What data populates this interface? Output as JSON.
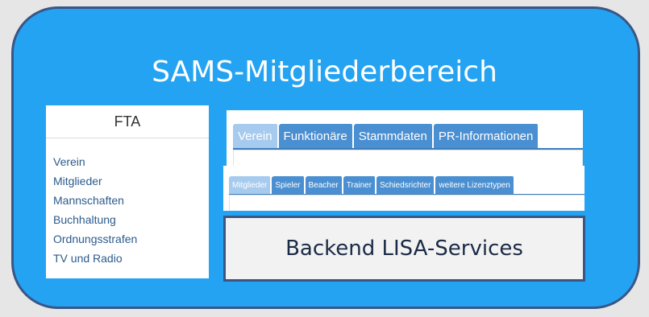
{
  "diagram": {
    "title": "SAMS-Mitgliederbereich"
  },
  "fta_menu": {
    "heading": "FTA",
    "items": [
      "Verein",
      "Mitglieder",
      "Mannschaften",
      "Buchhaltung",
      "Ordnungsstrafen",
      "TV und Radio"
    ]
  },
  "primary_tabs": {
    "items": [
      {
        "label": "Verein",
        "active": true
      },
      {
        "label": "Funktionäre",
        "active": false
      },
      {
        "label": "Stammdaten",
        "active": false
      },
      {
        "label": "PR-Informationen",
        "active": false
      }
    ]
  },
  "secondary_tabs": {
    "items": [
      {
        "label": "Mitglieder",
        "active": true
      },
      {
        "label": "Spieler",
        "active": false
      },
      {
        "label": "Beacher",
        "active": false
      },
      {
        "label": "Trainer",
        "active": false
      },
      {
        "label": "Schiedsrichter",
        "active": false
      },
      {
        "label": "weitere Lizenztypen",
        "active": false
      }
    ]
  },
  "backend": {
    "label": "Backend LISA-Services"
  },
  "colors": {
    "panel_fill": "#24a3f2",
    "panel_border": "#3a5686",
    "tab_fill": "#4a8fd1",
    "tab_active_fill": "#a6cbee",
    "menu_link": "#2b5b8c",
    "backend_fill": "#f2f2f2"
  }
}
